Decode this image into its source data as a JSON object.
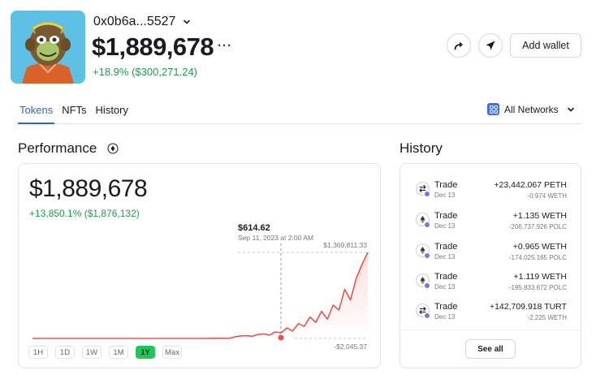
{
  "account": {
    "address": "0x0b6a...5527",
    "balance": "$1,889,678",
    "more": "···",
    "change": "+18.9% ($300,271.24)"
  },
  "actions": {
    "add_wallet": "Add wallet"
  },
  "tabs": [
    {
      "label": "Tokens",
      "active": true
    },
    {
      "label": "NFTs",
      "active": false
    },
    {
      "label": "History",
      "active": false
    }
  ],
  "networks": {
    "label": "All Networks"
  },
  "performance": {
    "title": "Performance",
    "value": "$1,889,678",
    "change": "+13,850.1% ($1,876,132)",
    "tooltip_value": "$614.62",
    "tooltip_date": "Sep 11, 2023 at 2:00 AM",
    "max_label": "$1,369,811.33",
    "min_label": "-$2,045.37",
    "ranges": [
      "1H",
      "1D",
      "1W",
      "1M",
      "1Y",
      "Max"
    ],
    "active_range": "1Y"
  },
  "chart_data": {
    "type": "line",
    "title": "",
    "xlabel": "",
    "ylabel": "",
    "series": [
      {
        "values": [
          -2045,
          -2045,
          -2045,
          -2045,
          -2045,
          -2045,
          -2045,
          -2045,
          -2045,
          -2045,
          -2045,
          -2045,
          -2045,
          -2045,
          -2045,
          -2045,
          -2045,
          -2045,
          -2045,
          -2045,
          -2045,
          -2045,
          -2045,
          -2045,
          -2045,
          -2045,
          -2045,
          -2045,
          -2045,
          -2045,
          -2045,
          615,
          615,
          615,
          615,
          23000,
          38000,
          42000,
          31000,
          61000,
          70000,
          52000,
          101000,
          87000,
          165000,
          117000,
          235000,
          190000,
          340000,
          255000,
          430000,
          305000,
          530000,
          450000,
          780000,
          610000,
          960000,
          1180000,
          1369811
        ]
      }
    ],
    "highlight": {
      "label": "$614.62",
      "date": "Sep 11, 2023 at 2:00 AM"
    },
    "ylim": [
      -2045.37,
      1369811.33
    ],
    "grid": false,
    "color": "#e8534a"
  },
  "history": {
    "title": "History",
    "see_all": "See all",
    "items": [
      {
        "type": "Trade",
        "date": "Dec 13",
        "amount": "+23,442.067 PETH",
        "sub": "-0.974 WETH"
      },
      {
        "type": "Trade",
        "date": "Dec 13",
        "amount": "+1.135 WETH",
        "sub": "-206,737.926 POLC"
      },
      {
        "type": "Trade",
        "date": "Dec 13",
        "amount": "+0.965 WETH",
        "sub": "-174,025.165 POLC"
      },
      {
        "type": "Trade",
        "date": "Dec 13",
        "amount": "+1.119 WETH",
        "sub": "-195,833.672 POLC"
      },
      {
        "type": "Trade",
        "date": "Dec 13",
        "amount": "+142,709.918 TURT",
        "sub": "-2.225 WETH"
      }
    ]
  },
  "colors": {
    "accent": "#2f64c8",
    "positive": "#1f9a4a",
    "chart_line": "#e8534a",
    "range_active": "#1fc75a"
  }
}
